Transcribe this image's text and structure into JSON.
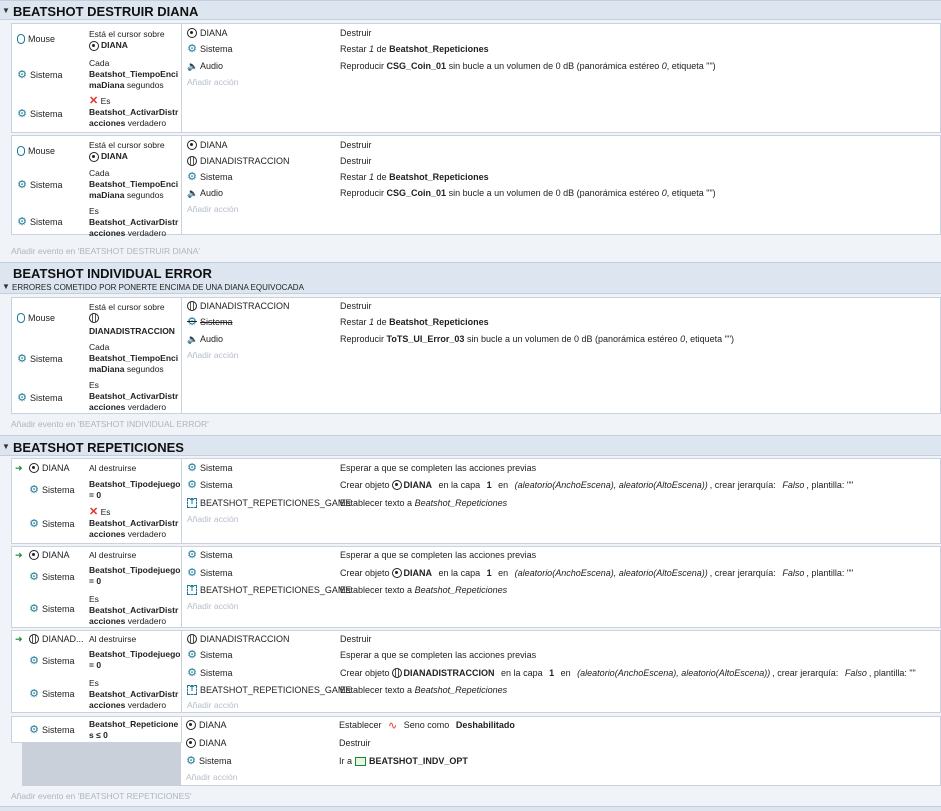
{
  "groups": {
    "g1": {
      "title": "BEATSHOT DESTRUIR DIANA",
      "footer": "Añadir evento en 'BEATSHOT DESTRUIR DIANA'"
    },
    "g2": {
      "title": "BEATSHOT INDIVIDUAL ERROR",
      "subtitle": "ERRORES COMETIDO POR PONERTE ENCIMA DE UNA DIANA EQUIVOCADA",
      "footer": "Añadir evento en 'BEATSHOT INDIVIDUAL ERROR'"
    },
    "g3": {
      "title": "BEATSHOT REPETICIONES",
      "footer": "Añadir evento en 'BEATSHOT REPETICIONES'"
    }
  },
  "common": {
    "mouse": "Mouse",
    "sistema": "Sistema",
    "diana": "DIANA",
    "dianadistraccion": "DIANADISTRACCION",
    "dianad_short": "DIANAD...",
    "audio": "Audio",
    "game_text": "BEATSHOT_REPETICIONES_GAME",
    "add_action": "Añadir acción",
    "cursor_over": "Está el cursor sobre",
    "cada": "Cada",
    "tiempo_var": "Beatshot_TiempoEncimaDiana",
    "segundos": "segundos",
    "es": "Es",
    "activar_var": "Beatshot_ActivarDistracciones",
    "verdadero": "verdadero",
    "al_destruirse": "Al destruirse",
    "tipo_var": "Beatshot_Tipodejuego = 0",
    "rep_cond": "Beatshot_Repeticiones ≤ 0",
    "destruir": "Destruir",
    "restar": "Restar",
    "restar_val": "1",
    "restar_de": "de",
    "rep_var": "Beatshot_Repeticiones",
    "reproducir": "Reproducir",
    "coin": "CSG_Coin_01",
    "error_sound": "ToTS_UI_Error_03",
    "sound_tail": "sin bucle a un volumen de 0 dB (panorámica estéreo",
    "pan_zero": "0",
    "etiqueta": ", etiqueta \"\")",
    "esperar": "Esperar a que se completen las acciones previas",
    "crear_objeto": "Crear objeto",
    "en_capa": "en la capa",
    "capa_val": "1",
    "en": "en",
    "pos_expr": "(aleatorio(AnchoEscena), aleatorio(AltoEscena))",
    "crear_tail": ", crear jerarquía:",
    "falso": "Falso",
    "plantilla": ", plantilla: \"\"",
    "establecer_texto": "Establecer texto a",
    "establecer": "Establecer",
    "seno": "Seno como",
    "deshabilitado": "Deshabilitado",
    "ir_a": "Ir a",
    "scene_name": "BEATSHOT_INDV_OPT"
  }
}
